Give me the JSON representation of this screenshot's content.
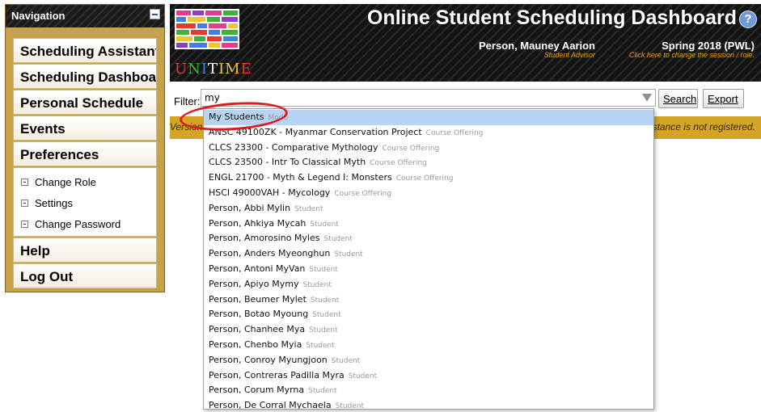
{
  "nav": {
    "title": "Navigation",
    "items": [
      {
        "label": "Scheduling Assistant"
      },
      {
        "label": "Scheduling Dashboard"
      },
      {
        "label": "Personal Schedule"
      },
      {
        "label": "Events"
      },
      {
        "label": "Preferences"
      }
    ],
    "preferences_sub": [
      {
        "label": "Change Role"
      },
      {
        "label": "Settings"
      },
      {
        "label": "Change Password"
      }
    ],
    "bottom_items": [
      {
        "label": "Help"
      },
      {
        "label": "Log Out"
      }
    ]
  },
  "header": {
    "logo_text": [
      "U",
      "N",
      "I",
      "T",
      "IM",
      "E"
    ],
    "title": "Online Student Scheduling Dashboard",
    "help_icon": "help-icon",
    "user_name": "Person, Mauney Aarion",
    "user_role": "Student Advisor",
    "session": "Spring 2018 (PWL)",
    "session_hint": "Click here to change the session / role."
  },
  "filter": {
    "label": "Filter:",
    "value": "my",
    "search_label": "Search",
    "export_label": "Export"
  },
  "message": {
    "left": "Version",
    "right": "stance is not registered."
  },
  "suggestions": [
    {
      "text": "My Students",
      "hint": "Mode",
      "selected": true
    },
    {
      "text": "ANSC 49100ZK - Myanmar Conservation Project",
      "hint": "Course Offering"
    },
    {
      "text": "CLCS 23300 - Comparative Mythology",
      "hint": "Course Offering"
    },
    {
      "text": "CLCS 23500 - Intr To Classical Myth",
      "hint": "Course Offering"
    },
    {
      "text": "ENGL 21700 - Myth & Legend I: Monsters",
      "hint": "Course Offering"
    },
    {
      "text": "HSCI 49000VAH - Mycology",
      "hint": "Course Offering"
    },
    {
      "text": "Person, Abbi Mylin",
      "hint": "Student"
    },
    {
      "text": "Person, Ahkiya Mycah",
      "hint": "Student"
    },
    {
      "text": "Person, Amorosino Myles",
      "hint": "Student"
    },
    {
      "text": "Person, Anders Myeonghun",
      "hint": "Student"
    },
    {
      "text": "Person, Antoni MyVan",
      "hint": "Student"
    },
    {
      "text": "Person, Apiyo Mymy",
      "hint": "Student"
    },
    {
      "text": "Person, Beumer Mylet",
      "hint": "Student"
    },
    {
      "text": "Person, Botao Myoung",
      "hint": "Student"
    },
    {
      "text": "Person, Chanhee Mya",
      "hint": "Student"
    },
    {
      "text": "Person, Chenbo Myia",
      "hint": "Student"
    },
    {
      "text": "Person, Conroy Myungjoon",
      "hint": "Student"
    },
    {
      "text": "Person, Contreras Padilla Myra",
      "hint": "Student"
    },
    {
      "text": "Person, Corum Myrna",
      "hint": "Student"
    },
    {
      "text": "Person, De Corral Mychaela",
      "hint": "Student"
    }
  ],
  "colors": {
    "nav_gold": "#c6a24a",
    "message_bar": "#d4a524",
    "selected_row": "#b7d4f3",
    "annotation_red": "#e01a1a",
    "user_role_orange": "#e6a21c"
  }
}
